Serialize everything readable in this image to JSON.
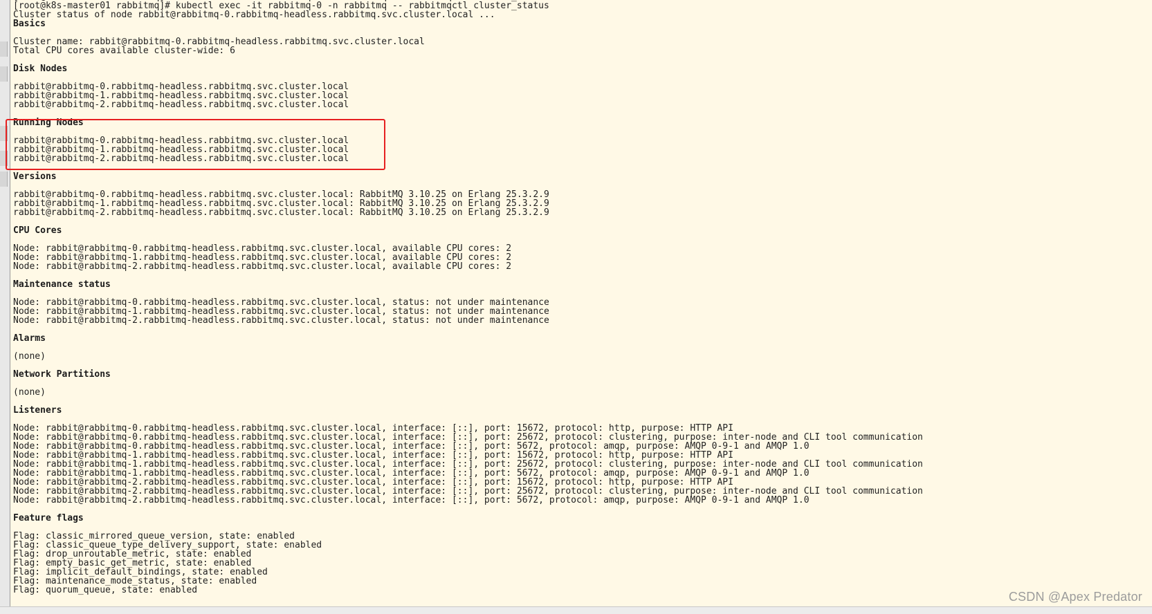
{
  "terminal": {
    "lines": [
      {
        "text": "[root@k8s-master01 rabbitmq]# kubectl exec -it rabbitmq-0 -n rabbitmq -- rabbitmqctl cluster_status",
        "heading": false
      },
      {
        "text": "[root@k8s-master01 rabbitmq]# kubectl exec -it rabbitmq-0 -n rabbitmq -- rabbitmqctl cluster_status",
        "heading": false
      },
      {
        "text": "Cluster status of node rabbit@rabbitmq-0.rabbitmq-headless.rabbitmq.svc.cluster.local ...",
        "heading": false
      },
      {
        "text": "Basics",
        "heading": true
      },
      {
        "text": "",
        "heading": false
      },
      {
        "text": "Cluster name: rabbit@rabbitmq-0.rabbitmq-headless.rabbitmq.svc.cluster.local",
        "heading": false
      },
      {
        "text": "Total CPU cores available cluster-wide: 6",
        "heading": false
      },
      {
        "text": "",
        "heading": false
      },
      {
        "text": "Disk Nodes",
        "heading": true
      },
      {
        "text": "",
        "heading": false
      },
      {
        "text": "rabbit@rabbitmq-0.rabbitmq-headless.rabbitmq.svc.cluster.local",
        "heading": false
      },
      {
        "text": "rabbit@rabbitmq-1.rabbitmq-headless.rabbitmq.svc.cluster.local",
        "heading": false
      },
      {
        "text": "rabbit@rabbitmq-2.rabbitmq-headless.rabbitmq.svc.cluster.local",
        "heading": false
      },
      {
        "text": "",
        "heading": false
      },
      {
        "text": "Running Nodes",
        "heading": true
      },
      {
        "text": "",
        "heading": false
      },
      {
        "text": "rabbit@rabbitmq-0.rabbitmq-headless.rabbitmq.svc.cluster.local",
        "heading": false
      },
      {
        "text": "rabbit@rabbitmq-1.rabbitmq-headless.rabbitmq.svc.cluster.local",
        "heading": false
      },
      {
        "text": "rabbit@rabbitmq-2.rabbitmq-headless.rabbitmq.svc.cluster.local",
        "heading": false
      },
      {
        "text": "",
        "heading": false
      },
      {
        "text": "Versions",
        "heading": true
      },
      {
        "text": "",
        "heading": false
      },
      {
        "text": "rabbit@rabbitmq-0.rabbitmq-headless.rabbitmq.svc.cluster.local: RabbitMQ 3.10.25 on Erlang 25.3.2.9",
        "heading": false
      },
      {
        "text": "rabbit@rabbitmq-1.rabbitmq-headless.rabbitmq.svc.cluster.local: RabbitMQ 3.10.25 on Erlang 25.3.2.9",
        "heading": false
      },
      {
        "text": "rabbit@rabbitmq-2.rabbitmq-headless.rabbitmq.svc.cluster.local: RabbitMQ 3.10.25 on Erlang 25.3.2.9",
        "heading": false
      },
      {
        "text": "",
        "heading": false
      },
      {
        "text": "CPU Cores",
        "heading": true
      },
      {
        "text": "",
        "heading": false
      },
      {
        "text": "Node: rabbit@rabbitmq-0.rabbitmq-headless.rabbitmq.svc.cluster.local, available CPU cores: 2",
        "heading": false
      },
      {
        "text": "Node: rabbit@rabbitmq-1.rabbitmq-headless.rabbitmq.svc.cluster.local, available CPU cores: 2",
        "heading": false
      },
      {
        "text": "Node: rabbit@rabbitmq-2.rabbitmq-headless.rabbitmq.svc.cluster.local, available CPU cores: 2",
        "heading": false
      },
      {
        "text": "",
        "heading": false
      },
      {
        "text": "Maintenance status",
        "heading": true
      },
      {
        "text": "",
        "heading": false
      },
      {
        "text": "Node: rabbit@rabbitmq-0.rabbitmq-headless.rabbitmq.svc.cluster.local, status: not under maintenance",
        "heading": false
      },
      {
        "text": "Node: rabbit@rabbitmq-1.rabbitmq-headless.rabbitmq.svc.cluster.local, status: not under maintenance",
        "heading": false
      },
      {
        "text": "Node: rabbit@rabbitmq-2.rabbitmq-headless.rabbitmq.svc.cluster.local, status: not under maintenance",
        "heading": false
      },
      {
        "text": "",
        "heading": false
      },
      {
        "text": "Alarms",
        "heading": true
      },
      {
        "text": "",
        "heading": false
      },
      {
        "text": "(none)",
        "heading": false
      },
      {
        "text": "",
        "heading": false
      },
      {
        "text": "Network Partitions",
        "heading": true
      },
      {
        "text": "",
        "heading": false
      },
      {
        "text": "(none)",
        "heading": false
      },
      {
        "text": "",
        "heading": false
      },
      {
        "text": "Listeners",
        "heading": true
      },
      {
        "text": "",
        "heading": false
      },
      {
        "text": "Node: rabbit@rabbitmq-0.rabbitmq-headless.rabbitmq.svc.cluster.local, interface: [::], port: 15672, protocol: http, purpose: HTTP API",
        "heading": false
      },
      {
        "text": "Node: rabbit@rabbitmq-0.rabbitmq-headless.rabbitmq.svc.cluster.local, interface: [::], port: 25672, protocol: clustering, purpose: inter-node and CLI tool communication",
        "heading": false
      },
      {
        "text": "Node: rabbit@rabbitmq-0.rabbitmq-headless.rabbitmq.svc.cluster.local, interface: [::], port: 5672, protocol: amqp, purpose: AMQP 0-9-1 and AMQP 1.0",
        "heading": false
      },
      {
        "text": "Node: rabbit@rabbitmq-1.rabbitmq-headless.rabbitmq.svc.cluster.local, interface: [::], port: 15672, protocol: http, purpose: HTTP API",
        "heading": false
      },
      {
        "text": "Node: rabbit@rabbitmq-1.rabbitmq-headless.rabbitmq.svc.cluster.local, interface: [::], port: 25672, protocol: clustering, purpose: inter-node and CLI tool communication",
        "heading": false
      },
      {
        "text": "Node: rabbit@rabbitmq-1.rabbitmq-headless.rabbitmq.svc.cluster.local, interface: [::], port: 5672, protocol: amqp, purpose: AMQP 0-9-1 and AMQP 1.0",
        "heading": false
      },
      {
        "text": "Node: rabbit@rabbitmq-2.rabbitmq-headless.rabbitmq.svc.cluster.local, interface: [::], port: 15672, protocol: http, purpose: HTTP API",
        "heading": false
      },
      {
        "text": "Node: rabbit@rabbitmq-2.rabbitmq-headless.rabbitmq.svc.cluster.local, interface: [::], port: 25672, protocol: clustering, purpose: inter-node and CLI tool communication",
        "heading": false
      },
      {
        "text": "Node: rabbit@rabbitmq-2.rabbitmq-headless.rabbitmq.svc.cluster.local, interface: [::], port: 5672, protocol: amqp, purpose: AMQP 0-9-1 and AMQP 1.0",
        "heading": false
      },
      {
        "text": "",
        "heading": false
      },
      {
        "text": "Feature flags",
        "heading": true
      },
      {
        "text": "",
        "heading": false
      },
      {
        "text": "Flag: classic_mirrored_queue_version, state: enabled",
        "heading": false
      },
      {
        "text": "Flag: classic_queue_type_delivery_support, state: enabled",
        "heading": false
      },
      {
        "text": "Flag: drop_unroutable_metric, state: enabled",
        "heading": false
      },
      {
        "text": "Flag: empty_basic_get_metric, state: enabled",
        "heading": false
      },
      {
        "text": "Flag: implicit_default_bindings, state: enabled",
        "heading": false
      },
      {
        "text": "Flag: maintenance_mode_status, state: enabled",
        "heading": false
      },
      {
        "text": "Flag: quorum_queue, state: enabled",
        "heading": false
      }
    ]
  },
  "watermark": "CSDN @Apex   Predator",
  "colors": {
    "background": "#fff9e6",
    "text": "#222222",
    "highlight": "#e62020"
  }
}
